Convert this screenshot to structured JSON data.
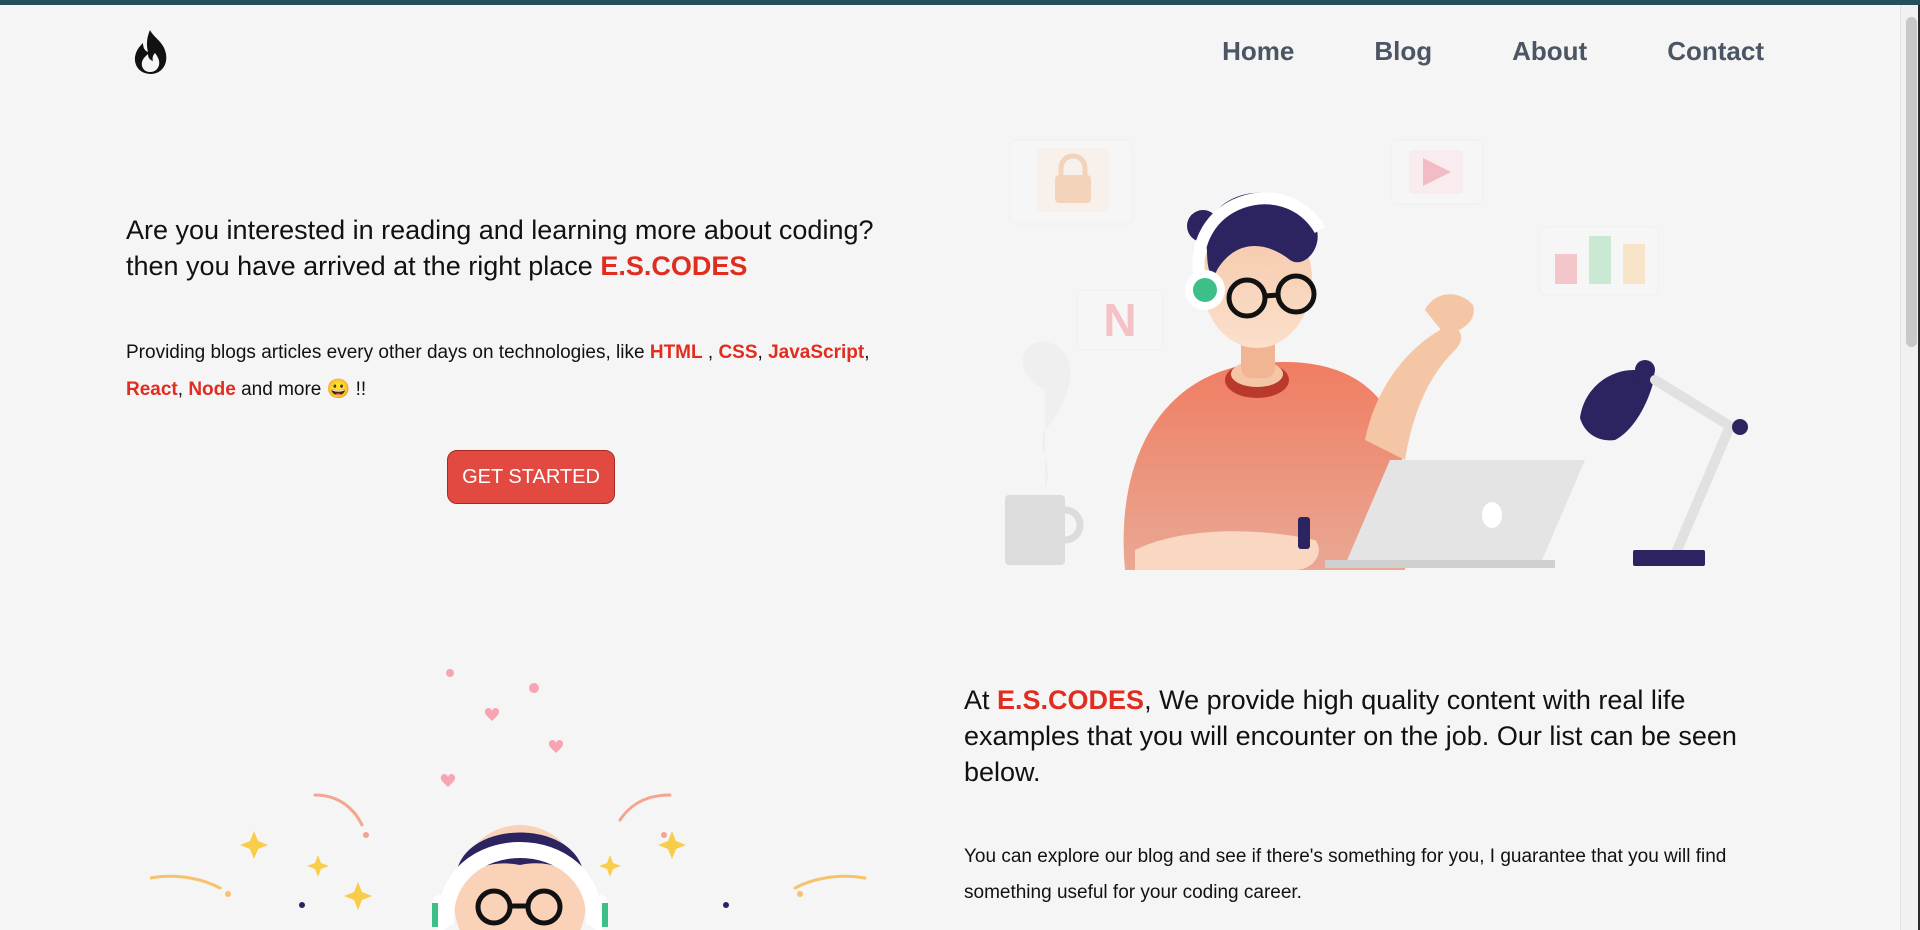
{
  "nav": {
    "logo_icon": "flame-icon",
    "items": [
      {
        "label": "Home"
      },
      {
        "label": "Blog"
      },
      {
        "label": "About"
      },
      {
        "label": "Contact"
      }
    ]
  },
  "hero": {
    "heading_line1": "Are you interested in reading and learning more about coding?",
    "heading_line2": "then you have arrived at the right place",
    "brand": "E.S.CODES",
    "para_intro": "Providing blogs articles every other days on technologies, like",
    "tech": [
      "HTML",
      "CSS",
      "JavaScript",
      "React",
      "Node"
    ],
    "sep_space_comma": " ,",
    "sep_comma": ",",
    "para_end": "and more",
    "emoji": "😀",
    "exclaim": "!!",
    "cta_label": "GET STARTED"
  },
  "about": {
    "heading_prefix": "At",
    "brand": "E.S.CODES",
    "heading_rest": ", We provide high quality content with real life examples that you will encounter on the job. Our list can be seen below.",
    "paragraph": "You can explore our blog and see if there's something for you, I guarantee that you will find something useful for your coding career."
  },
  "illustration_letters": {
    "n_card": "N"
  },
  "colors": {
    "accent": "#e12d1f",
    "button": "#e24a41",
    "nav_text": "#4b5563",
    "topbar": "#23505c"
  }
}
